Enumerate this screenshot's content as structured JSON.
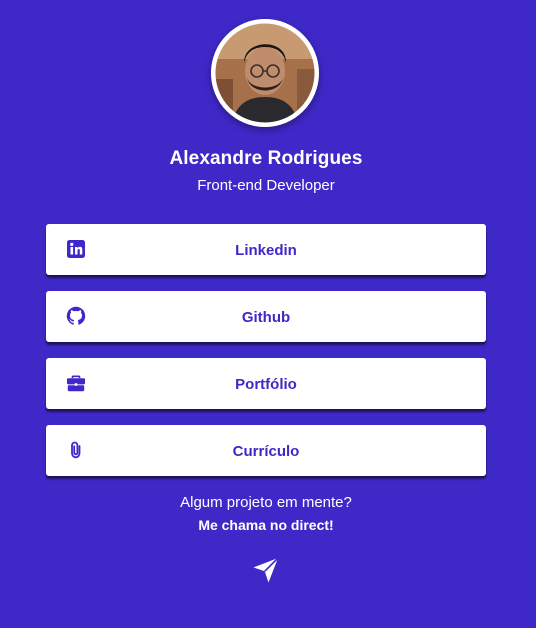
{
  "profile": {
    "name": "Alexandre Rodrigues",
    "role": "Front-end Developer"
  },
  "links": [
    {
      "label": "Linkedin",
      "icon": "linkedin-icon"
    },
    {
      "label": "Github",
      "icon": "github-icon"
    },
    {
      "label": "Portfólio",
      "icon": "briefcase-icon"
    },
    {
      "label": "Currículo",
      "icon": "paperclip-icon"
    }
  ],
  "contact": {
    "question": "Algum projeto em mente?",
    "action": "Me chama no direct!",
    "icon": "send-icon"
  },
  "colors": {
    "background": "#3f28c8",
    "accent": "#3f28c8",
    "card": "#ffffff",
    "text": "#ffffff"
  }
}
